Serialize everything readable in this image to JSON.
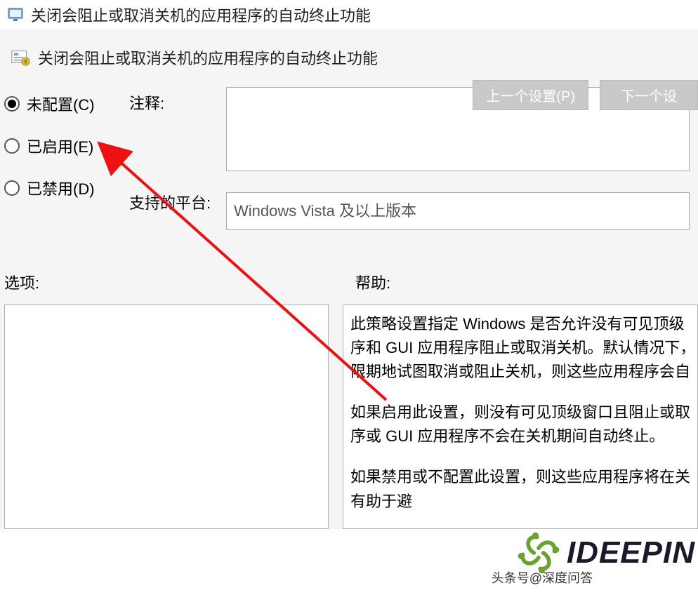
{
  "window": {
    "title": "关闭会阻止或取消关机的应用程序的自动终止功能"
  },
  "header": {
    "policy_title": "关闭会阻止或取消关机的应用程序的自动终止功能",
    "prev_button": "上一个设置(P)",
    "next_button": "下一个设"
  },
  "state": {
    "options": [
      {
        "label": "未配置(C)",
        "selected": true
      },
      {
        "label": "已启用(E)",
        "selected": false
      },
      {
        "label": "已禁用(D)",
        "selected": false
      }
    ]
  },
  "labels": {
    "comment": "注释:",
    "supported_on": "支持的平台:",
    "options": "选项:",
    "help": "帮助:"
  },
  "fields": {
    "comment_value": "",
    "supported_value": "Windows Vista 及以上版本"
  },
  "help": {
    "p1": "此策略设置指定 Windows 是否允许没有可见顶级序和 GUI 应用程序阻止或取消关机。默认情况下，限期地试图取消或阻止关机，则这些应用程序会自",
    "p2": "如果启用此设置，则没有可见顶级窗口且阻止或取序或 GUI 应用程序不会在关机期间自动终止。",
    "p3": "如果禁用或不配置此设置，则这些应用程序将在关有助于避"
  },
  "watermark": {
    "brand": "IDEEPIN",
    "attribution": "头条号@深度问答"
  }
}
